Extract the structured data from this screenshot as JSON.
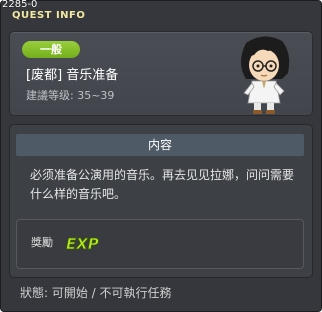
{
  "window": {
    "frame_id": "2285-0",
    "title": "QUEST INFO"
  },
  "quest": {
    "category": "一般",
    "title": "[废都] 音乐准备",
    "level": "建議等级: 35~39",
    "npc_icon": "npc-portrait-icon"
  },
  "content": {
    "header": "内容",
    "body": "必须准备公演用的音乐。再去见见拉娜，问问需要什么样的音乐吧。"
  },
  "reward": {
    "label": "獎勵",
    "exp_text": "EXP"
  },
  "status": {
    "text": "狀態: 可開始 / 不可執行任務"
  },
  "colors": {
    "title": "#f2e8a0",
    "category_badge": "#86c02c",
    "exp_icon": "#b4ea24",
    "background": "#35373c"
  }
}
